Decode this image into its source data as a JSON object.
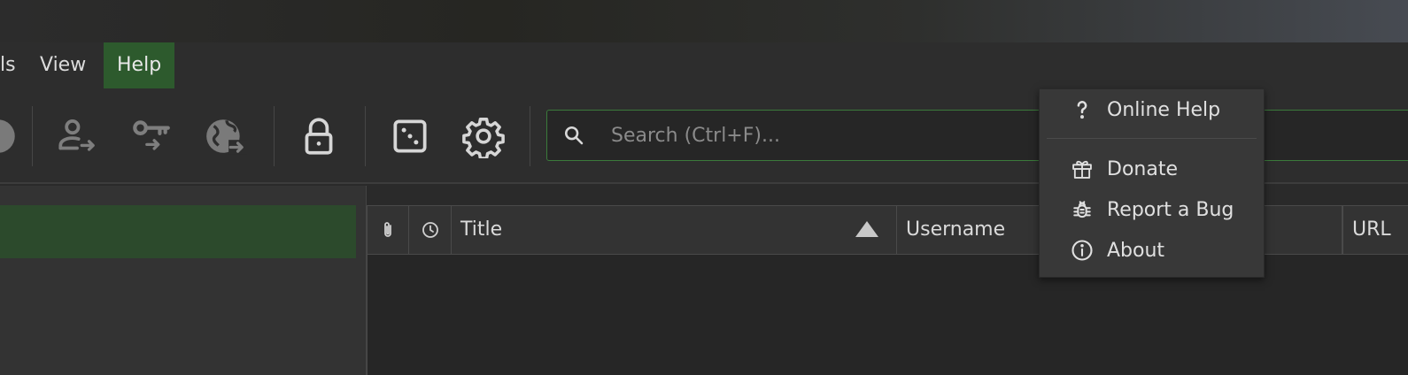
{
  "menubar": {
    "items": [
      {
        "label": "ls"
      },
      {
        "label": "View"
      },
      {
        "label": "Help",
        "active": true
      }
    ]
  },
  "toolbar": {
    "buttons": [
      {
        "icon": "partial-icon"
      },
      {
        "icon": "copy-username-icon"
      },
      {
        "icon": "copy-password-icon"
      },
      {
        "icon": "copy-url-icon"
      },
      {
        "icon": "lock-database-icon"
      },
      {
        "icon": "password-generator-dice-icon"
      },
      {
        "icon": "settings-gear-icon"
      }
    ],
    "search": {
      "placeholder": "Search (Ctrl+F)...",
      "value": ""
    }
  },
  "entry_table": {
    "columns": [
      {
        "label": "",
        "icon": "attachment-icon"
      },
      {
        "label": "",
        "icon": "clock-icon"
      },
      {
        "label": "Title",
        "sorted": "ascending"
      },
      {
        "label": "Username"
      },
      {
        "label": ""
      },
      {
        "label": "URL"
      }
    ],
    "rows": []
  },
  "help_menu": {
    "items": [
      {
        "label": "Online Help",
        "icon": "question-mark-icon"
      },
      {
        "label": "Donate",
        "icon": "gift-icon"
      },
      {
        "label": "Report a Bug",
        "icon": "bug-icon"
      },
      {
        "label": "About",
        "icon": "info-icon"
      }
    ]
  },
  "colors": {
    "accent_green": "#2d5a2d",
    "search_border": "#3b7a3b",
    "background": "#2d2d2d",
    "menu_bg": "#383838"
  }
}
